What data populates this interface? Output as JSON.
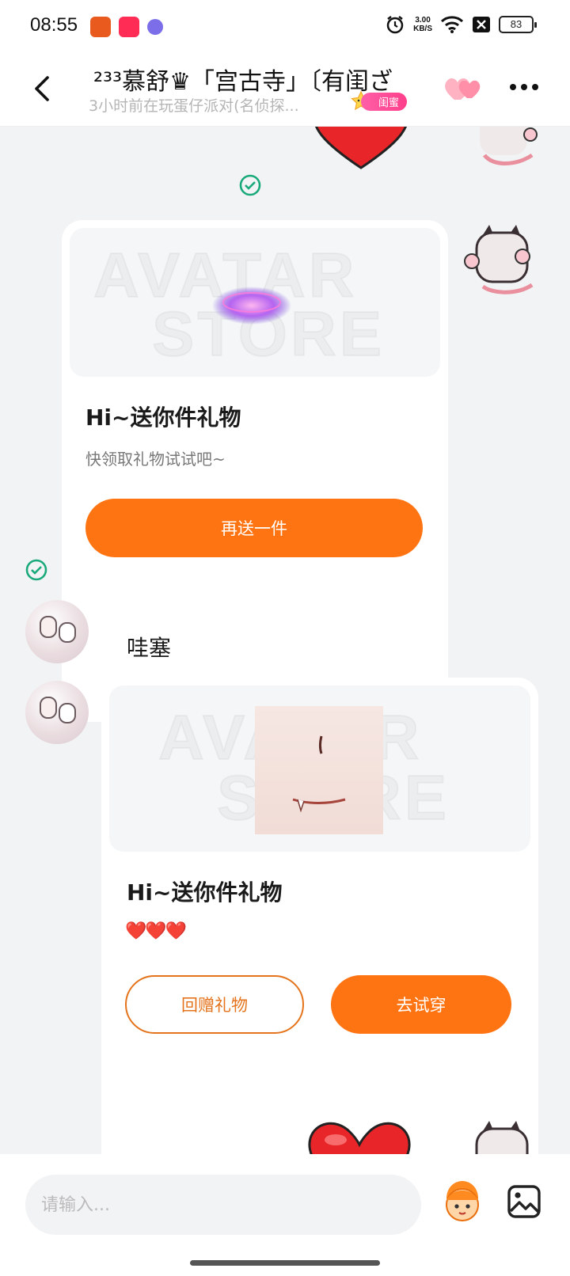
{
  "status_bar": {
    "time": "08:55",
    "net_speed_value": "3.00",
    "net_speed_unit": "KB/S",
    "battery": "83"
  },
  "header": {
    "title": "²³³慕舒♛「宫古寺」〔有闺ざ",
    "subtitle": "3小时前在玩蛋仔派对(名侦探...",
    "badge_label": "闺蜜"
  },
  "messages": {
    "gift_card_1": {
      "watermark_line1": "AVATAR",
      "watermark_line2": "STORE",
      "title": "Hi~送你件礼物",
      "subtitle": "快领取礼物试试吧~",
      "button_label": "再送一件"
    },
    "text_bubble": {
      "text": "哇塞"
    },
    "gift_card_2": {
      "watermark_line1": "AVATAR",
      "watermark_line2": "STORE",
      "title": "Hi~送你件礼物",
      "hearts": "❤️❤️❤️",
      "return_gift_label": "回赠礼物",
      "try_on_label": "去试穿"
    }
  },
  "input": {
    "placeholder": "请输入..."
  },
  "colors": {
    "accent_orange": "#ff7412",
    "outline_orange": "#e4731b",
    "check_green": "#1aaa7a",
    "heart_red": "#e8262a",
    "badge_pink": "#ff4f96"
  },
  "icons": {
    "back": "back-arrow-icon",
    "hearts": "double-heart-icon",
    "more": "more-dots-icon",
    "check": "check-circle-icon",
    "emoji": "avatar-emoji-icon",
    "image": "image-picker-icon"
  }
}
